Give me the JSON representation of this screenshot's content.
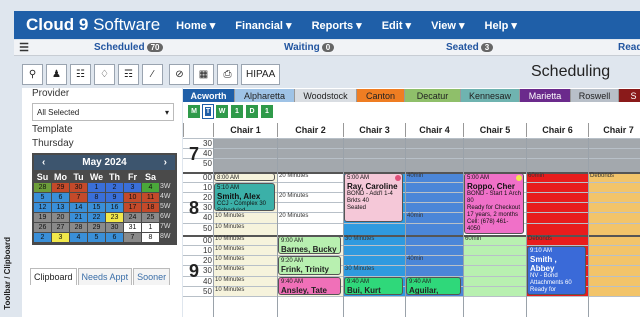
{
  "app": {
    "brand_bold": "Cloud 9",
    "brand_rest": " Software",
    "menus": [
      "Home ▾",
      "Financial ▾",
      "Reports ▾",
      "Edit ▾",
      "View ▾",
      "Help ▾"
    ]
  },
  "status": {
    "scheduled": "Scheduled",
    "scheduled_count": "70",
    "waiting": "Waiting",
    "waiting_count": "0",
    "seated": "Seated",
    "seated_count": "3",
    "ready": "Read"
  },
  "toolbar": {
    "hipaa": "HIPAA",
    "title": "Scheduling"
  },
  "left": {
    "provider_label": "Provider",
    "provider_value": "All Selected",
    "template_label": "Template",
    "template_value": "Thursday",
    "cal": {
      "month": "May 2024",
      "prev": "‹",
      "next": "›",
      "dow": [
        "Su",
        "Mo",
        "Tu",
        "We",
        "Th",
        "Fr",
        "Sa"
      ],
      "weeks": [
        {
          "days": [
            "28",
            "29",
            "30",
            "1",
            "2",
            "3",
            "4"
          ],
          "wk": "3W"
        },
        {
          "days": [
            "5",
            "6",
            "7",
            "8",
            "9",
            "10",
            "11"
          ],
          "wk": "4W"
        },
        {
          "days": [
            "12",
            "13",
            "14",
            "15",
            "16",
            "17",
            "18"
          ],
          "wk": "5W"
        },
        {
          "days": [
            "19",
            "20",
            "21",
            "22",
            "23",
            "24",
            "25"
          ],
          "wk": "6W"
        },
        {
          "days": [
            "26",
            "27",
            "28",
            "29",
            "30",
            "31",
            "1"
          ],
          "wk": "7W"
        },
        {
          "days": [
            "2",
            "3",
            "4",
            "5",
            "6",
            "7",
            "8"
          ],
          "wk": "8W"
        }
      ]
    },
    "tabs": [
      "Clipboard",
      "Needs Appt",
      "Sooner"
    ],
    "sidetab": "Toolbar / Clipboard"
  },
  "locations": [
    {
      "label": "Acworth",
      "bg": "#1f5fa8",
      "fg": "#ffffff"
    },
    {
      "label": "Alpharetta",
      "bg": "#9fc3e6",
      "fg": "#222222"
    },
    {
      "label": "Woodstock",
      "bg": "#d9dde2",
      "fg": "#222222"
    },
    {
      "label": "Canton",
      "bg": "#ef7d22",
      "fg": "#222222"
    },
    {
      "label": "Decatur",
      "bg": "#8fbf6a",
      "fg": "#222222"
    },
    {
      "label": "Kennesaw",
      "bg": "#6fb3b0",
      "fg": "#222222"
    },
    {
      "label": "Marietta",
      "bg": "#6b2a8c",
      "fg": "#ffffff"
    },
    {
      "label": "Roswell",
      "bg": "#b8bfc8",
      "fg": "#222222"
    },
    {
      "label": "S",
      "bg": "#8a1a1a",
      "fg": "#ffffff"
    }
  ],
  "subtabs": [
    "M",
    "T",
    "W",
    "1",
    "D",
    "1"
  ],
  "chairs": [
    "Chair 1",
    "Chair 2",
    "Chair 3",
    "Chair 4",
    "Chair 5",
    "Chair 6",
    "Chair 7"
  ],
  "hours": [
    "7",
    "8",
    "9"
  ],
  "minutes": [
    "30",
    "40",
    "50",
    "00",
    "10",
    "20",
    "30",
    "40",
    "50",
    "00",
    "10",
    "20",
    "30",
    "40",
    "50"
  ],
  "slot_labels": {
    "ten": "10 Minutes",
    "twenty": "20 Minutes",
    "thirty": "30 Minutes",
    "forty": "40min",
    "sixty": "60min",
    "debonds": "Debonds",
    "scheduled": "Scheduled"
  },
  "appointments": {
    "a1": {
      "time": "5:10 AM",
      "name": "Smith, Alex",
      "l1": "CCJ - Complex 30",
      "l2": "Scheduled"
    },
    "a2": {
      "time": "5:00 AM",
      "name": "Ray, Caroline",
      "l1": "BOND - Add'l 1-4",
      "l2": "Brkts 40",
      "l3": "Seated"
    },
    "a3": {
      "time": "5:00 AM",
      "name": "Roppo, Cher",
      "l1": "BOND - Start 1 Arch 80",
      "l2": "Ready for Checkout",
      "l3": "17 years, 2 months",
      "l4": "Cell: (678) 461-4050",
      "l5": "E-Mail"
    },
    "a4": {
      "time": "9:00 AM",
      "name": "Barnes, Bucky"
    },
    "a5": {
      "time": "9:20 AM",
      "name": "Frink, Trinity"
    },
    "a6": {
      "time": "9:10 AM",
      "name": "Smith , Abbey",
      "l1": "NV - Bond",
      "l2": "Attachments 60",
      "l3": "Ready for Checkout",
      "l4": "14 years, 8 months"
    },
    "a7": {
      "time": "9:40 AM",
      "name": "Ansley, Tate"
    },
    "a8": {
      "time": "9:40 AM",
      "name": "Bui, Kurt"
    },
    "a9": {
      "time": "9:40 AM",
      "name": "Aguilar, Tanya"
    },
    "a10": {
      "time": "8:00 AM"
    }
  },
  "colors": {
    "brand": "#1f5fa8",
    "cal_today": "#f2e84a"
  }
}
